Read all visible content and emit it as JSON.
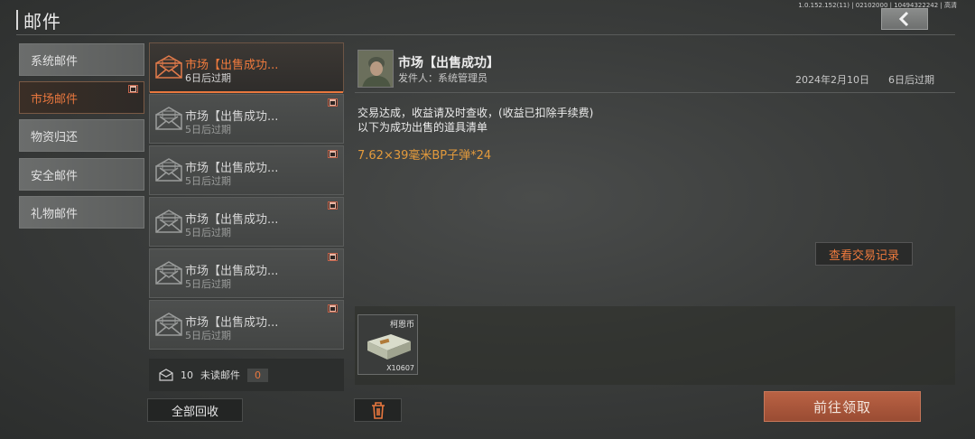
{
  "header": {
    "title": "邮件",
    "version": "1.0.152.152(11) | 02102000 | 10494322242 | 高清"
  },
  "categories": [
    {
      "label": "系统邮件",
      "active": false
    },
    {
      "label": "市场邮件",
      "active": true,
      "gift": true
    },
    {
      "label": "物资归还",
      "active": false
    },
    {
      "label": "安全邮件",
      "active": false
    },
    {
      "label": "礼物邮件",
      "active": false
    }
  ],
  "mails": [
    {
      "subject": "市场【出售成功...",
      "expire": "6日后过期",
      "active": true
    },
    {
      "subject": "市场【出售成功...",
      "expire": "5日后过期",
      "gift": true
    },
    {
      "subject": "市场【出售成功...",
      "expire": "5日后过期",
      "gift": true
    },
    {
      "subject": "市场【出售成功...",
      "expire": "5日后过期",
      "gift": true
    },
    {
      "subject": "市场【出售成功...",
      "expire": "5日后过期",
      "gift": true
    },
    {
      "subject": "市场【出售成功...",
      "expire": "5日后过期",
      "gift": true
    }
  ],
  "unread": {
    "count": "10",
    "label": "未读邮件",
    "value": "0"
  },
  "buttons": {
    "recall_all": "全部回收",
    "claim": "前往领取",
    "view_records": "查看交易记录"
  },
  "detail": {
    "title": "市场【出售成功】",
    "sender": "发件人：系统管理员",
    "date": "2024年2月10日",
    "expire": "6日后过期",
    "body_line1": "交易达成，收益请及时查收，(收益已扣除手续费)",
    "body_line2": "以下为成功出售的道具清单",
    "item": "7.62×39毫米BP子弹*24"
  },
  "attachment": {
    "name": "柯恩币",
    "quantity": "X10607"
  },
  "colors": {
    "accent": "#e8773e",
    "claim": "#a9553a",
    "item": "#e39a3c"
  }
}
